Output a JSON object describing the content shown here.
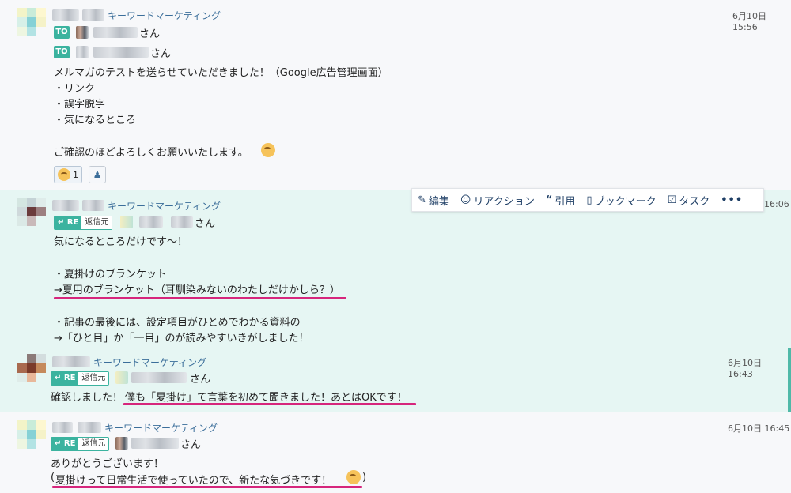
{
  "room_name": "キーワードマーケティング",
  "san": "さん",
  "to_label": "TO",
  "re_label": "RE",
  "reply_source_label": "返信元",
  "colors": {
    "accent": "#3bb39f",
    "underline": "#d6267c",
    "link": "#3b6e9a",
    "highlight_bg": "#e6f6f3"
  },
  "message1": {
    "time": "6月10日 15:56",
    "body": [
      "メルマガのテストを送らせていただきました！（Google広告管理画面）",
      "・リンク",
      "・誤字脱字",
      "・気になるところ",
      "",
      "ご確認のほどよろしくお願いいたします。"
    ],
    "reaction_count": "1",
    "reaction_emoji": "grin-sweat-emoji",
    "person_icon": "user-list-icon"
  },
  "toolbar": {
    "edit": "編集",
    "reaction": "リアクション",
    "quote": "引用",
    "bookmark": "ブックマーク",
    "task": "タスク",
    "more": "•••"
  },
  "message2": {
    "time": "16:06",
    "body": [
      "気になるところだけです～！",
      "",
      "・夏掛けのブランケット",
      "→夏用のブランケット（耳馴染みないのわたしだけかしら？）",
      "",
      "・記事の最後には、設定項目がひとめでわかる資料の",
      "→「ひと目」か「一目」のが読みやすいきがしました！"
    ]
  },
  "message3": {
    "time": "6月10日 16:43",
    "body_prefix": "確認しました！",
    "body_underlined": "僕も「夏掛け」て言葉を初めて聞きました！あとはOKです！"
  },
  "message4": {
    "time": "6月10日 16:45",
    "body": "ありがとうございます！",
    "body2_open": "(",
    "body2_underlined": "夏掛けって日常生活で使っていたので、新たな気づきです！",
    "body2_close": ")"
  }
}
